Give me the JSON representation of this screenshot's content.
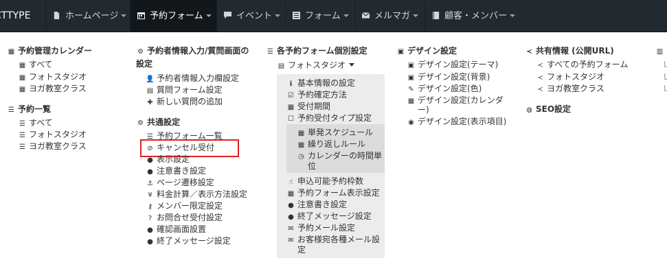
{
  "navbar": {
    "brand": "CTTYPE",
    "items": [
      {
        "label": "ホームページ",
        "icon": "file-icon",
        "active": false
      },
      {
        "label": "予約フォーム",
        "icon": "calendar-icon",
        "active": true
      },
      {
        "label": "イベント",
        "icon": "comment-icon",
        "active": false
      },
      {
        "label": "フォーム",
        "icon": "list-alt-icon",
        "active": false
      },
      {
        "label": "メルマガ",
        "icon": "envelope-icon",
        "active": false
      },
      {
        "label": "顧客・メンバー",
        "icon": "book-icon",
        "active": false
      }
    ]
  },
  "col1": {
    "calendar_head": "予約管理カレンダー",
    "calendar_items": [
      "すべて",
      "フォトスタジオ",
      "ヨガ教室クラス"
    ],
    "list_head": "予約一覧",
    "list_items": [
      "すべて",
      "フォトスタジオ",
      "ヨガ教室クラス"
    ]
  },
  "col2": {
    "head1_line1": "予約者情報入力/質問画面の",
    "head1_line2": "設定",
    "head1_items": [
      "予約者情報入力欄設定",
      "質問フォーム設定",
      "新しい質問の追加"
    ],
    "head2": "共通設定",
    "head2_items": [
      "予約フォーム一覧",
      "キャンセル受付",
      "表示設定",
      "注意書き設定",
      "ページ遷移設定",
      "料金計算／表示方法設定",
      "メンバー限定設定",
      "お問合せ受付設定",
      "確認画面設置",
      "終了メッセージ設定"
    ]
  },
  "col3": {
    "head": "各予約フォーム個別設定",
    "selector": "フォトスタジオ",
    "items_a": [
      "基本情報の設定",
      "予約確定方法",
      "受付期間",
      "予約受付タイプ設定"
    ],
    "items_b": [
      "単発スケジュール",
      "繰り返しルール",
      "カレンダーの時間単",
      "位"
    ],
    "items_c": [
      "申込可能予約枠数",
      "予約フォーム表示設定",
      "注意書き設定",
      "終了メッセージ設定",
      "予約メール設定",
      "お客様宛各種メール設",
      "定"
    ]
  },
  "col4": {
    "head": "デザイン設定",
    "items": [
      "デザイン設定(テーマ)",
      "デザイン設定(背景)",
      "デザイン設定(色)",
      "デザイン設定(カレンダ",
      "ー)",
      "デザイン設定(表示項目)"
    ]
  },
  "col5": {
    "share_head": "共有情報 (公開URL)",
    "share_items": [
      "すべての予約フォーム",
      "フォトスタジオ",
      "ヨガ教室クラス"
    ],
    "seo_head": "SEO設定"
  }
}
